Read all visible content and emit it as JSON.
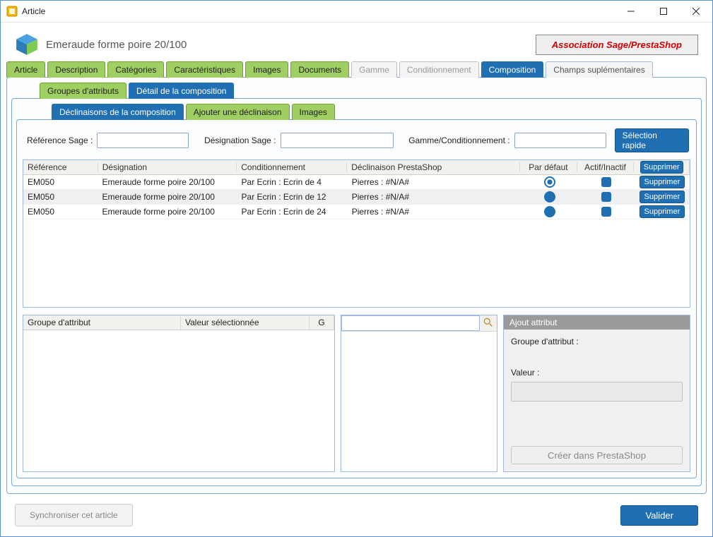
{
  "window": {
    "title": "Article"
  },
  "header": {
    "page_title": "Emeraude forme poire 20/100",
    "assoc_label": "Association Sage/PrestaShop"
  },
  "tabs_main": {
    "article": "Article",
    "description": "Description",
    "categories": "Catégories",
    "caracteristiques": "Caractéristiques",
    "images": "Images",
    "documents": "Documents",
    "gamme": "Gamme",
    "conditionnement": "Conditionnement",
    "composition": "Composition",
    "champs_supl": "Champs suplémentaires"
  },
  "tabs_mid": {
    "groupes_attributs": "Groupes d'attributs",
    "detail_compo": "Détail de la composition"
  },
  "tabs_inner": {
    "declinaisons": "Déclinaisons de la composition",
    "ajouter": "Ajouter une déclinaison",
    "images": "Images"
  },
  "filters": {
    "ref_sage_label": "Référence Sage :",
    "desig_sage_label": "Désignation Sage :",
    "gamme_cond_label": "Gamme/Conditionnement :",
    "selection_rapide": "Sélection rapide"
  },
  "grid": {
    "headers": {
      "reference": "Référence",
      "designation": "Désignation",
      "conditionnement": "Conditionnement",
      "declinaison": "Déclinaison PrestaShop",
      "par_defaut": "Par défaut",
      "actif": "Actif/Inactif",
      "supprimer": "Supprimer"
    },
    "rows": [
      {
        "ref": "EM050",
        "des": "Emeraude forme poire 20/100",
        "cond": "Par Ecrin : Ecrin de 4",
        "decl": "Pierres : #N/A#",
        "def": "open",
        "act": true,
        "sup": "Supprimer"
      },
      {
        "ref": "EM050",
        "des": "Emeraude forme poire 20/100",
        "cond": "Par Ecrin : Ecrin de 12",
        "decl": "Pierres : #N/A#",
        "def": "full",
        "act": true,
        "sup": "Supprimer"
      },
      {
        "ref": "EM050",
        "des": "Emeraude forme poire 20/100",
        "cond": "Par Ecrin : Ecrin de 24",
        "decl": "Pierres : #N/A#",
        "def": "full",
        "act": true,
        "sup": "Supprimer"
      }
    ]
  },
  "lower": {
    "groupe_attribut": "Groupe d'attribut",
    "valeur_select": "Valeur sélectionnée",
    "g": "G",
    "ajout_attribut": "Ajout attribut",
    "groupe_attr_label": "Groupe d'attribut :",
    "valeur_label": "Valeur :",
    "creer_presta": "Créer dans PrestaShop"
  },
  "footer": {
    "sync": "Synchroniser cet article",
    "valider": "Valider"
  }
}
